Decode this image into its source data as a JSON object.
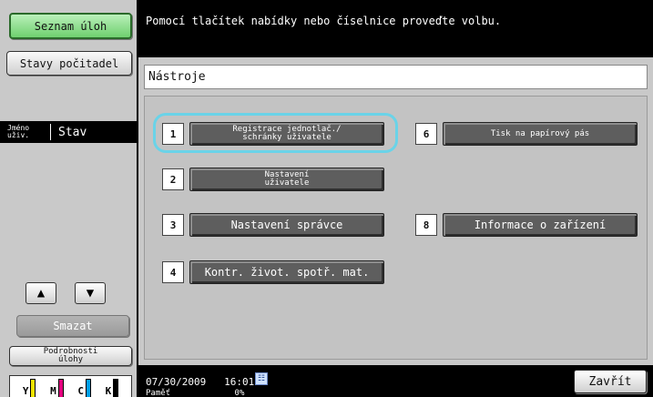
{
  "message": "Pomocí tlačítek nabídky nebo číselnice proveďte volbu.",
  "left_panel": {
    "job_list": "Seznam úloh",
    "counters": "Stavy počitadel",
    "status_header": {
      "col1_line1": "Jméno",
      "col1_line2": "uživ.",
      "col2": "Stav"
    },
    "up_icon": "up-arrow-icon",
    "down_icon": "down-arrow-icon",
    "delete": "Smazat",
    "details_line1": "Podrobnosti",
    "details_line2": "úlohy",
    "toner": [
      "Y",
      "M",
      "C",
      "K"
    ],
    "toner_colors": [
      "#f2e400",
      "#e4007f",
      "#00a0e9",
      "#000000"
    ]
  },
  "panel_title": "Nástroje",
  "menu": [
    {
      "num": "1",
      "line1": "Registrace jednotlač./",
      "line2": "schránky uživatele"
    },
    {
      "num": "2",
      "line1": "Nastavení",
      "line2": "uživatele"
    },
    {
      "num": "3",
      "label": "Nastavení správce"
    },
    {
      "num": "4",
      "label": "Kontr. život. spotř. mat."
    },
    {
      "num": "6",
      "label": "Tisk na papírový pás"
    },
    {
      "num": "8",
      "label": "Informace o zařízení"
    }
  ],
  "bottom": {
    "date": "07/30/2009",
    "time": "16:01",
    "memory_label": "Paměť",
    "memory_value": "0%",
    "close": "Zavřít"
  },
  "colors": {
    "highlight": "#6ad3e8",
    "active_green": "#6fd06f"
  }
}
